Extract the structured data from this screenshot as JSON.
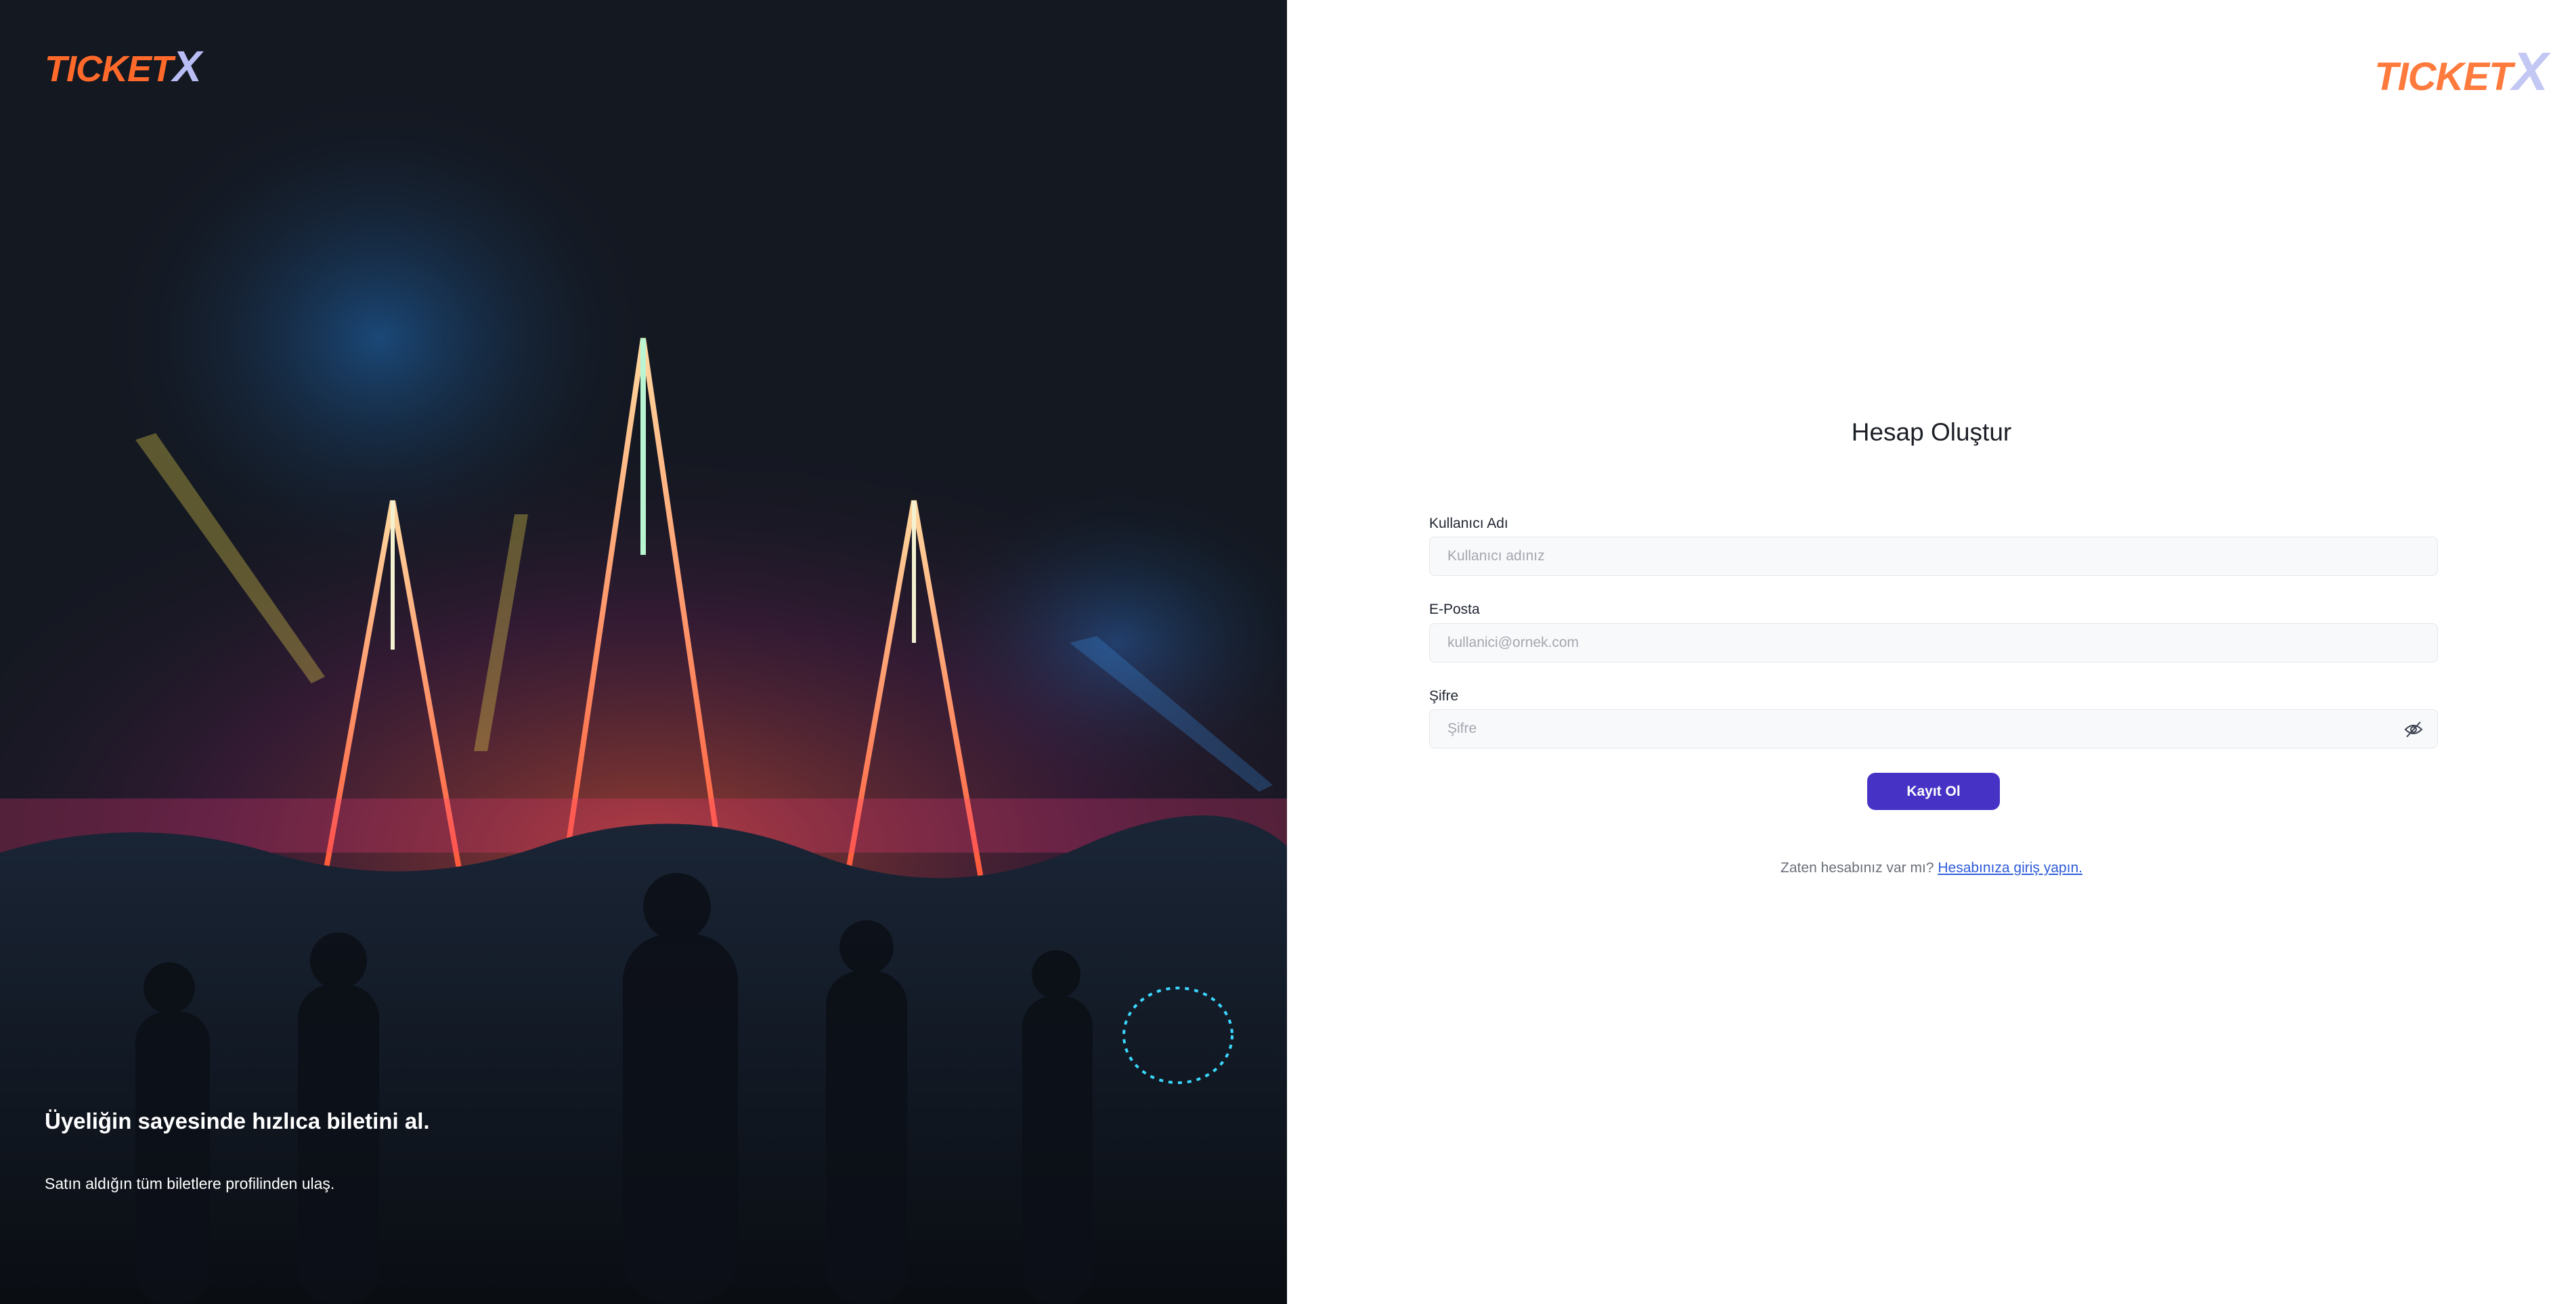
{
  "brand": {
    "logo_text_primary": "TICKET",
    "logo_text_secondary": "X",
    "primary_color": "#ff6a2b",
    "secondary_color": "#b9bdf5"
  },
  "hero": {
    "image_icon": "festival-crowd-photo",
    "headline": "Üyeliğin sayesinde hızlıca biletini al.",
    "subheadline": "Satın aldığın tüm biletlere profilinden ulaş."
  },
  "form": {
    "title": "Hesap Oluştur",
    "fields": [
      {
        "label": "Kullanıcı Adı",
        "placeholder": "Kullanıcı adınız",
        "value": ""
      },
      {
        "label": "E-Posta",
        "placeholder": "kullanici@ornek.com",
        "value": ""
      },
      {
        "label": "Şifre",
        "placeholder": "Şifre",
        "value": "",
        "toggle_icon": "eye-off-icon"
      }
    ],
    "submit_label": "Kayıt Ol",
    "accent_color": "#4632c4"
  },
  "footer": {
    "question": "Zaten hesabınız var mı?",
    "link_text": "Hesabınıza giriş yapın."
  }
}
